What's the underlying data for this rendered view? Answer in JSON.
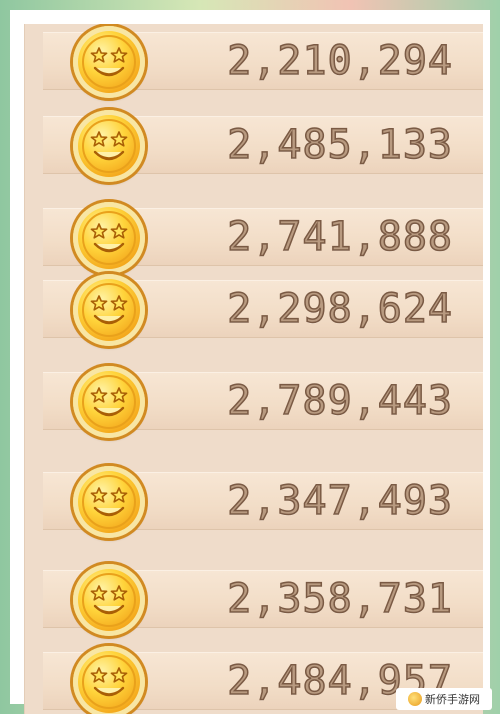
{
  "list": {
    "entries": [
      {
        "icon": "gold-coin-icon",
        "amount": "2,210,294"
      },
      {
        "icon": "gold-coin-icon",
        "amount": "2,485,133"
      },
      {
        "icon": "gold-coin-icon",
        "amount": "2,741,888"
      },
      {
        "icon": "gold-coin-icon",
        "amount": "2,298,624"
      },
      {
        "icon": "gold-coin-icon",
        "amount": "2,789,443"
      },
      {
        "icon": "gold-coin-icon",
        "amount": "2,347,493"
      },
      {
        "icon": "gold-coin-icon",
        "amount": "2,358,731"
      },
      {
        "icon": "gold-coin-icon",
        "amount": "2,484,957"
      }
    ]
  },
  "watermark": {
    "text": "新侨手游网"
  },
  "colors": {
    "panel": "#efdcca",
    "coin": "#ffd43b",
    "amount_text": "#b89a80"
  }
}
